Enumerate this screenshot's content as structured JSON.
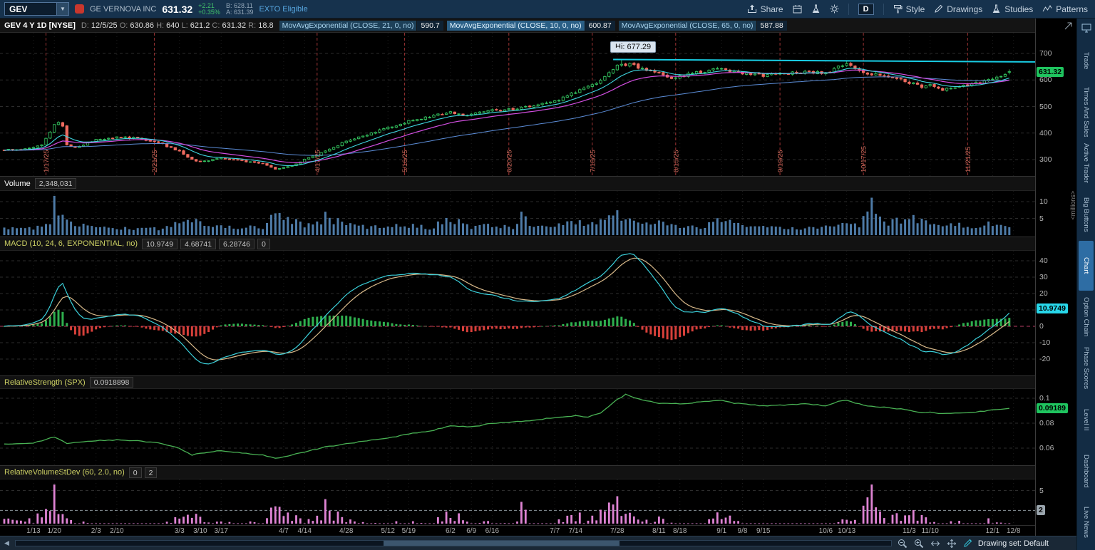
{
  "toolbar": {
    "symbol": "GEV",
    "company": "GE VERNOVA INC",
    "last": "631.32",
    "change": "+2.21",
    "change_pct": "+0.35%",
    "bid": "B: 628.11",
    "ask": "A: 631.39",
    "exto": "EXTO Eligible",
    "right_items": [
      {
        "icon": "share",
        "label": "Share",
        "name": "share-button"
      },
      {
        "icon": "calendar",
        "label": "",
        "name": "calendar-button"
      },
      {
        "icon": "flask",
        "label": "",
        "name": "quick-study-button"
      },
      {
        "icon": "gear",
        "label": "",
        "name": "chart-settings-button"
      },
      {
        "sep": true
      },
      {
        "box": "D",
        "name": "timeframe-button"
      },
      {
        "sep": true
      },
      {
        "icon": "style",
        "label": "Style",
        "name": "style-button"
      },
      {
        "icon": "pencil",
        "label": "Drawings",
        "name": "drawings-button"
      },
      {
        "icon": "flask",
        "label": "Studies",
        "name": "studies-button"
      },
      {
        "icon": "patterns",
        "label": "Patterns",
        "name": "patterns-button"
      }
    ]
  },
  "chart_header": {
    "title": "GEV 4 Y 1D [NYSE]",
    "ohlc": [
      [
        "D:",
        "12/5/25"
      ],
      [
        "O:",
        "630.86"
      ],
      [
        "H:",
        "640"
      ],
      [
        "L:",
        "621.2"
      ],
      [
        "C:",
        "631.32"
      ],
      [
        "R:",
        "18.8"
      ]
    ],
    "studies": [
      {
        "label": "MovAvgExponential (CLOSE, 21, 0, no)",
        "value": "590.7",
        "hl": false
      },
      {
        "label": "MovAvgExponential (CLOSE, 10, 0, no)",
        "value": "600.87",
        "hl": true
      },
      {
        "label": "MovAvgExponential (CLOSE, 65, 0, no)",
        "value": "587.88",
        "hl": false
      }
    ]
  },
  "price_panel": {
    "hi_tooltip": "Hi: 677.29"
  },
  "panels": {
    "volume": {
      "label": "Volume",
      "value": "2,348,031"
    },
    "macd": {
      "label": "MACD (10, 24, 6, EXPONENTIAL, no)",
      "values": [
        "10.9749",
        "4.68741",
        "6.28746",
        "0"
      ]
    },
    "rs": {
      "label": "RelativeStrength (SPX)",
      "value": "0.0918898"
    },
    "rvol": {
      "label": "RelativeVolumeStDev (60, 2.0, no)",
      "values": [
        "0",
        "2"
      ]
    }
  },
  "axis": {
    "price_ticks": [
      700,
      600,
      500,
      400,
      300
    ],
    "volume_ticks": [
      10,
      5
    ],
    "macd_ticks": [
      40,
      30,
      20,
      10,
      0,
      -10,
      -20
    ],
    "rs_ticks": [
      0.1,
      0.08,
      0.06
    ],
    "rvol_ticks": [
      5
    ],
    "price_badge": "631.32",
    "price_badge_value": 631.32,
    "macd_badge": "10.9749",
    "macd_badge_value": 10.9749,
    "rs_badge": "0.09189",
    "rs_badge_value": 0.0919,
    "rvol_badge": "2",
    "rvol_badge_value": 2,
    "millions_label": "<millions>"
  },
  "sidebar": {
    "tabs": [
      "Trade",
      "Times And Sales",
      "Active Trader",
      "Big Buttons",
      "Chart",
      "Option Chain",
      "Phase Scores",
      "Level II",
      "Dashboard",
      "Live News"
    ],
    "active": "Chart"
  },
  "statusbar": {
    "drawing_set_label": "Drawing set: Default",
    "icons": [
      {
        "icon": "zoomout",
        "name": "zoom-out-icon"
      },
      {
        "icon": "zoomin",
        "name": "zoom-in-icon"
      },
      {
        "icon": "fit",
        "name": "fit-width-icon"
      },
      {
        "icon": "pan",
        "name": "pan-icon"
      },
      {
        "icon": "pencil-cyan",
        "name": "drawing-pencil-icon"
      }
    ]
  },
  "chart_data": {
    "type": "candlestick-multi-panel",
    "symbol": "GEV",
    "timeframe": "4 Y 1D",
    "trading_days": 242,
    "price": {
      "ylim": [
        250,
        748
      ],
      "anchors_day": [
        0,
        5,
        9,
        12,
        13,
        14,
        15,
        17,
        22,
        27,
        32,
        37,
        42,
        45,
        47,
        52,
        57,
        62,
        65,
        67,
        70,
        72,
        77,
        82,
        87,
        92,
        97,
        102,
        107,
        110,
        112,
        117,
        122,
        127,
        132,
        137,
        142,
        145,
        147,
        150,
        153,
        157,
        160,
        162,
        167,
        172,
        175,
        177,
        182,
        187,
        192,
        197,
        200,
        202,
        205,
        207,
        212,
        215,
        217,
        220,
        222,
        225,
        228,
        232,
        237,
        239,
        241
      ],
      "anchors_close": [
        335,
        340,
        355,
        430,
        440,
        425,
        355,
        345,
        375,
        385,
        380,
        365,
        330,
        300,
        290,
        305,
        295,
        285,
        265,
        270,
        282,
        300,
        330,
        370,
        395,
        420,
        445,
        460,
        480,
        465,
        472,
        485,
        490,
        505,
        520,
        555,
        590,
        630,
        655,
        660,
        640,
        625,
        610,
        615,
        630,
        645,
        630,
        625,
        618,
        625,
        630,
        625,
        650,
        660,
        640,
        625,
        615,
        600,
        590,
        575,
        580,
        565,
        572,
        585,
        605,
        615,
        631.32
      ],
      "high_marks": [
        {
          "day": 148,
          "high": 677.29
        },
        {
          "day": 202,
          "high": 674.8
        }
      ],
      "last": {
        "open": 630.86,
        "high": 640,
        "low": 621.2,
        "close": 631.32
      }
    },
    "volume_millions": {
      "anchors_day": [
        0,
        5,
        9,
        11,
        12,
        13,
        14,
        15,
        17,
        22,
        27,
        32,
        37,
        42,
        45,
        47,
        52,
        57,
        62,
        65,
        67,
        72,
        76,
        77,
        78,
        82,
        87,
        92,
        97,
        102,
        107,
        112,
        117,
        122,
        124,
        127,
        132,
        137,
        142,
        145,
        147,
        150,
        153,
        157,
        162,
        167,
        172,
        177,
        182,
        187,
        192,
        197,
        202,
        205,
        208,
        210,
        212,
        217,
        222,
        225,
        228,
        232,
        237,
        239,
        241
      ],
      "anchors_value": [
        2,
        1.8,
        2.5,
        3,
        13,
        8,
        5,
        6,
        3,
        2.5,
        2.2,
        1.8,
        2,
        3.5,
        4.5,
        3.5,
        2.5,
        2.2,
        2.5,
        6,
        5,
        3,
        4,
        8,
        5,
        3,
        2.5,
        2.5,
        3,
        2.2,
        5,
        2.5,
        2.8,
        2.2,
        5.5,
        2.5,
        3,
        4,
        3.5,
        5.5,
        6,
        4,
        3,
        4,
        2.5,
        2.2,
        4.5,
        2.5,
        2.8,
        2.2,
        2,
        2.5,
        4,
        3,
        9.5,
        5,
        3.5,
        5,
        4,
        3,
        3.5,
        2.5,
        3.5,
        2.8,
        2.348
      ],
      "last": 2.348031
    },
    "macd": {
      "params": [
        10,
        24,
        6
      ],
      "last_value": 10.9749,
      "last_avg": 4.68741,
      "last_diff": 6.28746
    },
    "relative_strength": {
      "anchors_day": [
        0,
        7,
        12,
        15,
        22,
        27,
        32,
        37,
        42,
        45,
        47,
        52,
        57,
        62,
        65,
        67,
        72,
        77,
        82,
        87,
        92,
        97,
        102,
        107,
        112,
        117,
        122,
        127,
        132,
        137,
        140,
        143,
        147,
        149,
        152,
        155,
        157,
        162,
        167,
        172,
        175,
        177,
        182,
        187,
        192,
        197,
        200,
        202,
        205,
        207,
        212,
        217,
        220,
        222,
        225,
        228,
        232,
        237,
        241
      ],
      "anchors_value": [
        0.063,
        0.064,
        0.069,
        0.064,
        0.066,
        0.0665,
        0.066,
        0.064,
        0.06,
        0.0545,
        0.056,
        0.058,
        0.056,
        0.0545,
        0.052,
        0.053,
        0.057,
        0.061,
        0.0635,
        0.066,
        0.068,
        0.0715,
        0.0735,
        0.078,
        0.077,
        0.08,
        0.081,
        0.0825,
        0.0845,
        0.086,
        0.085,
        0.088,
        0.099,
        0.103,
        0.0995,
        0.0975,
        0.096,
        0.0955,
        0.097,
        0.0985,
        0.096,
        0.0955,
        0.094,
        0.0945,
        0.0955,
        0.094,
        0.0975,
        0.098,
        0.0955,
        0.094,
        0.0925,
        0.0905,
        0.0885,
        0.089,
        0.0875,
        0.088,
        0.0885,
        0.0905,
        0.0919
      ],
      "last": 0.0919
    },
    "rvol": {
      "window": 60,
      "threshold": 2
    },
    "trendline": {
      "x1_day": 146,
      "y1": 677.3,
      "x2_day": 247,
      "y2": 668
    },
    "events": [
      {
        "day": 10,
        "label": "1/17/25"
      },
      {
        "day": 36,
        "label": "2/21/25"
      },
      {
        "day": 75,
        "label": "4/17/25"
      },
      {
        "day": 96,
        "label": "5/16/25"
      },
      {
        "day": 121,
        "label": "6/20/25"
      },
      {
        "day": 141,
        "label": "7/18/25"
      },
      {
        "day": 161,
        "label": "8/15/25"
      },
      {
        "day": 186,
        "label": "9/19/25"
      },
      {
        "day": 206,
        "label": "10/17/25"
      },
      {
        "day": 231,
        "label": "11/21/25"
      }
    ],
    "x_labels": [
      {
        "day": 7,
        "label": "1/13"
      },
      {
        "day": 12,
        "label": "1/20"
      },
      {
        "day": 22,
        "label": "2/3"
      },
      {
        "day": 27,
        "label": "2/10"
      },
      {
        "day": 42,
        "label": "3/3"
      },
      {
        "day": 47,
        "label": "3/10"
      },
      {
        "day": 52,
        "label": "3/17"
      },
      {
        "day": 67,
        "label": "4/7"
      },
      {
        "day": 72,
        "label": "4/14"
      },
      {
        "day": 82,
        "label": "4/28"
      },
      {
        "day": 92,
        "label": "5/12"
      },
      {
        "day": 97,
        "label": "5/19"
      },
      {
        "day": 107,
        "label": "6/2"
      },
      {
        "day": 112,
        "label": "6/9"
      },
      {
        "day": 117,
        "label": "6/16"
      },
      {
        "day": 132,
        "label": "7/7"
      },
      {
        "day": 137,
        "label": "7/14"
      },
      {
        "day": 147,
        "label": "7/28"
      },
      {
        "day": 157,
        "label": "8/11"
      },
      {
        "day": 162,
        "label": "8/18"
      },
      {
        "day": 172,
        "label": "9/1"
      },
      {
        "day": 177,
        "label": "9/8"
      },
      {
        "day": 182,
        "label": "9/15"
      },
      {
        "day": 197,
        "label": "10/6"
      },
      {
        "day": 202,
        "label": "10/13"
      },
      {
        "day": 217,
        "label": "11/3"
      },
      {
        "day": 222,
        "label": "11/10"
      },
      {
        "day": 237,
        "label": "12/1"
      },
      {
        "day": 242,
        "label": "12/8"
      }
    ]
  }
}
